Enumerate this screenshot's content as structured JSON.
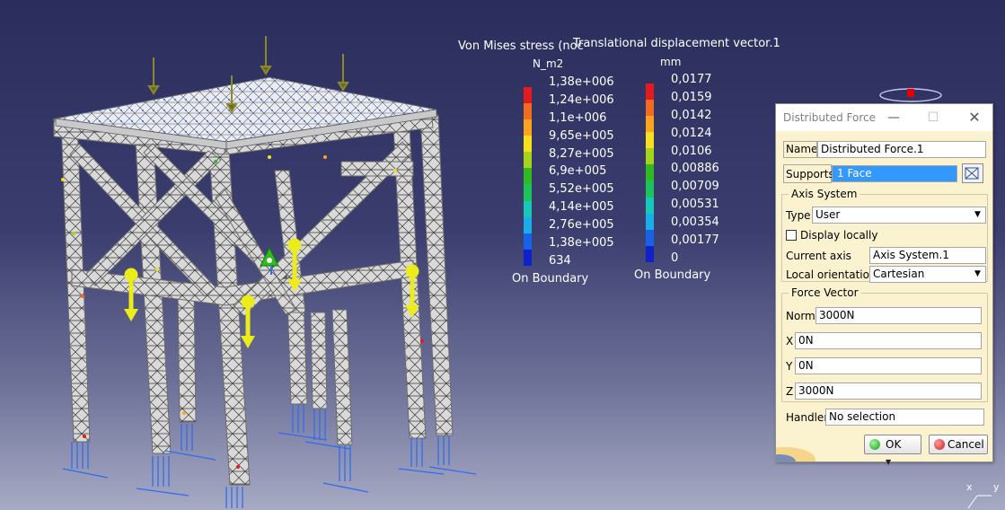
{
  "von_mises": {
    "title": "Von Mises stress (noc",
    "unit": "N_m2",
    "values": [
      "1,38e+006",
      "1,24e+006",
      "1,1e+006",
      "9,65e+005",
      "8,27e+005",
      "6,9e+005",
      "5,52e+005",
      "4,14e+005",
      "2,76e+005",
      "1,38e+005",
      "634"
    ],
    "boundary": "On Boundary"
  },
  "displacement": {
    "title": "Translational displacement vector.1",
    "unit": "mm",
    "values": [
      "0,0177",
      "0,0159",
      "0,0142",
      "0,0124",
      "0,0106",
      "0,00886",
      "0,00709",
      "0,00531",
      "0,00354",
      "0,00177",
      "0"
    ],
    "boundary": "On Boundary"
  },
  "colors": {
    "legend_scale": [
      "#e41a1c",
      "#f36b1f",
      "#fba41c",
      "#f8e11a",
      "#a6d41a",
      "#2fbb1f",
      "#1cc25a",
      "#18c8b6",
      "#19aee8",
      "#1763e8",
      "#0d22c8"
    ],
    "load_arrow": "#ecec1a",
    "restraint": "#2f6cf0",
    "accent": "#3399ff"
  },
  "triad": {
    "x": "x",
    "y": "y"
  },
  "dialog": {
    "title": "Distributed Force",
    "name_label": "Name",
    "name_value": "Distributed Force.1",
    "supports_label": "Supports",
    "supports_value": "1 Face",
    "axis_group": "Axis System",
    "type_label": "Type",
    "type_value": "User",
    "display_locally": "Display locally",
    "current_axis_label": "Current axis",
    "current_axis_value": "Axis System.1",
    "local_orientation_label": "Local orientation",
    "local_orientation_value": "Cartesian",
    "force_group": "Force Vector",
    "norm_label": "Norm",
    "norm_value": "3000N",
    "x_label": "X",
    "x_value": "0N",
    "y_label": "Y",
    "y_value": "0N",
    "z_label": "Z",
    "z_value": "3000N",
    "handler_label": "Handler",
    "handler_value": "No selection",
    "ok_label": "OK",
    "cancel_label": "Cancel"
  }
}
